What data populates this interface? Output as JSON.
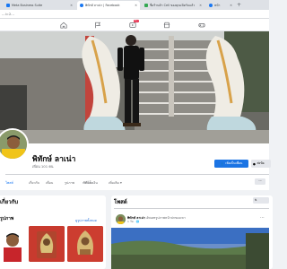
{
  "browser": {
    "tabs": [
      {
        "title": "Meta Business Suite",
        "color": "#1877f2"
      },
      {
        "title": "พิทักษ์ ลาเน่า | Facebook",
        "color": "#1877f2"
      },
      {
        "title": "ชื่อร้านค้า Cell ของคุณเปิดรับแล้ว",
        "color": "#34a853"
      },
      {
        "title": "หน้า",
        "color": "#1877f2"
      }
    ],
    "url": "...i=2..."
  },
  "fbnav": {
    "notification_count": "9+"
  },
  "profile": {
    "name": "พิทักษ์ ลาเน่า",
    "friends": "เพื่อน 101 คน",
    "add_friend_label": "เพิ่มเป็นเพื่อน",
    "message_label": "ส่งข้อ"
  },
  "profile_tabs": [
    "โพสต์",
    "เกี่ยวกับ",
    "เพื่อน",
    "รูปภาพ",
    "วิดีโอ",
    "การเช็คอิน",
    "เพิ่มเติม ▾"
  ],
  "left_card": {
    "title": "เกี่ยวกับ",
    "section": "รูปภาพ",
    "see_all": "ดูรูปภาพทั้งหมด"
  },
  "post_card": {
    "title": "โพสต์",
    "author": "พิทักษ์ ลาเน่า",
    "author_extra": "อัพเดทรูปภาพหน้าปกของเขา",
    "time": "1 วัน"
  },
  "colors": {
    "fb_blue": "#1877f2",
    "bg": "#f0f2f5"
  }
}
